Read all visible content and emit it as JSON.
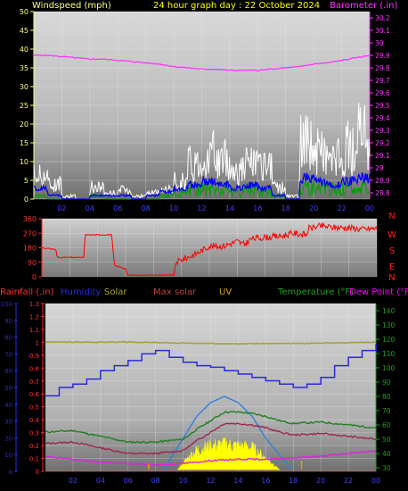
{
  "header": {
    "windspeed_label": "Windspeed (mph)",
    "title": "24 hour graph day : 22 October 2024",
    "barometer_label": "Barometer (.in)"
  },
  "legend3": {
    "rainfall": "Rainfall (.in)",
    "humidity": "Humidity",
    "solar": "Solar",
    "max_solar": "Max solar",
    "uv": "UV",
    "temperature": "Temperature (°F)",
    "dew_point": "Dew Point (°F)"
  },
  "compass": [
    "N",
    "W",
    "S",
    "E",
    "N"
  ],
  "colors": {
    "windspeed_label": "#ffff80",
    "title": "#ffff00",
    "barometer": "#ff33ff",
    "gust": "#ffffff",
    "wind_avg": "#0000ff",
    "wind_green": "#00a000",
    "direction": "#ff0000",
    "compass": "#ff2020",
    "rain_axis": "#ff3030",
    "humidity": "#2a2ae0",
    "solar": "#b0a820",
    "max_solar": "#c04040",
    "uv": "#e0a000",
    "temperature": "#20a020",
    "dew_point": "#ff00ff",
    "solar_fill": "#ffff00",
    "max_solar_curve": "#3080e0",
    "temp_line": "#208020",
    "temp_dark_line": "#a02050",
    "dew_line": "#e020e0",
    "solar_avg_line": "#a0a040"
  },
  "chart_data": [
    {
      "type": "line",
      "name": "wind_and_barometer",
      "x_ticks": [
        "02",
        "04",
        "06",
        "08",
        "10",
        "12",
        "14",
        "16",
        "18",
        "20",
        "22",
        "00"
      ],
      "y_left_ticks": [
        "0",
        "5",
        "10",
        "15",
        "20",
        "25",
        "30",
        "35",
        "40",
        "45",
        "50"
      ],
      "y_left_range": [
        0,
        50
      ],
      "y_right_ticks": [
        "28.8",
        "28.9",
        "29",
        "29.1",
        "29.2",
        "29.3",
        "29.4",
        "29.5",
        "29.6",
        "29.7",
        "29.8",
        "29.9",
        "30",
        "30.1",
        "30.2"
      ],
      "y_right_range": [
        28.75,
        30.25
      ],
      "series": [
        {
          "name": "Barometer (.in)",
          "x": [
            0,
            1,
            2,
            3,
            4,
            5,
            6,
            7,
            8,
            9,
            10,
            11,
            12,
            13,
            14,
            15,
            16,
            17,
            18,
            19,
            20,
            21,
            22,
            23,
            24
          ],
          "values": [
            29.9,
            29.9,
            29.89,
            29.88,
            29.87,
            29.87,
            29.86,
            29.85,
            29.84,
            29.83,
            29.81,
            29.8,
            29.79,
            29.79,
            29.78,
            29.78,
            29.78,
            29.79,
            29.8,
            29.81,
            29.83,
            29.84,
            29.86,
            29.88,
            29.9
          ]
        }
      ],
      "wind_gust_hourly": [
        8,
        5,
        1,
        0,
        4,
        2,
        3,
        1,
        2,
        3,
        6,
        12,
        15,
        13,
        10,
        12,
        10,
        4,
        1,
        19,
        16,
        13,
        17,
        21
      ],
      "wind_avg_hourly": [
        3,
        1,
        0,
        0,
        1,
        1,
        1,
        0,
        1,
        2,
        3,
        4,
        5,
        4,
        3,
        4,
        3,
        1,
        0,
        6,
        5,
        4,
        5,
        6
      ],
      "wind_green_hourly": [
        1,
        0,
        0,
        0,
        1,
        0,
        0,
        0,
        0,
        1,
        2,
        3,
        3,
        3,
        2,
        3,
        2,
        1,
        0,
        4,
        3,
        3,
        3,
        3
      ]
    },
    {
      "type": "line",
      "name": "wind_direction",
      "y_ticks": [
        "0",
        "90",
        "180",
        "270",
        "360"
      ],
      "y_range": [
        0,
        360
      ],
      "x": [
        0,
        1,
        1.1,
        3,
        3.1,
        5,
        5.2,
        6,
        6.1,
        9.5,
        9.6,
        11,
        12,
        13,
        14,
        14.5,
        15,
        16,
        17,
        18,
        19,
        19.1,
        20,
        21,
        22,
        23,
        24
      ],
      "values": [
        180,
        170,
        120,
        120,
        260,
        260,
        70,
        50,
        10,
        10,
        90,
        140,
        190,
        190,
        220,
        200,
        235,
        245,
        250,
        270,
        260,
        300,
        315,
        305,
        305,
        295,
        300
      ]
    },
    {
      "type": "line",
      "name": "rain_humidity_solar_temp",
      "y_left_rain_ticks": [
        "0",
        "0.1",
        "0.2",
        "0.3",
        "0.4",
        "0.5",
        "0.6",
        "0.7",
        "0.8",
        "0.9",
        "1",
        "1.1",
        "1.2",
        "1.3"
      ],
      "y_left_rain_range": [
        0,
        1.3
      ],
      "y_left_hum_ticks": [
        "0",
        "10",
        "20",
        "30",
        "40",
        "50",
        "60",
        "70",
        "80",
        "90",
        "100"
      ],
      "y_left_hum_range": [
        0,
        100
      ],
      "y_right_ticks": [
        "30",
        "40",
        "50",
        "60",
        "70",
        "80",
        "90",
        "100",
        "110",
        "120",
        "130",
        "140"
      ],
      "y_right_range": [
        27.5,
        145
      ],
      "series": [
        {
          "name": "Humidity",
          "x": [
            0,
            1,
            2,
            3,
            4,
            5,
            6,
            7,
            8,
            9,
            10,
            11,
            12,
            13,
            14,
            15,
            16,
            17,
            18,
            19,
            20,
            21,
            22,
            23,
            24
          ],
          "values": [
            45,
            50,
            52,
            55,
            60,
            63,
            66,
            70,
            72,
            68,
            65,
            63,
            62,
            60,
            58,
            56,
            54,
            52,
            50,
            52,
            56,
            63,
            68,
            72,
            76
          ]
        },
        {
          "name": "Temperature",
          "x": [
            0,
            2,
            4,
            6,
            8,
            10,
            11,
            12,
            13,
            14,
            15,
            16,
            17,
            18,
            20,
            22,
            24
          ],
          "values": [
            55,
            56,
            52,
            48,
            48,
            50,
            57,
            63,
            69,
            69,
            68,
            66,
            63,
            61,
            62,
            60,
            58
          ]
        },
        {
          "name": "Dew Point",
          "x": [
            0,
            2,
            4,
            6,
            8,
            10,
            12,
            14,
            16,
            18,
            20,
            22,
            24
          ],
          "values": [
            38,
            36,
            34,
            33,
            32,
            33,
            35,
            36,
            36,
            37,
            38,
            40,
            42
          ]
        },
        {
          "name": "Solar average",
          "x": [
            0,
            6,
            12,
            18,
            24
          ],
          "values": [
            118,
            118,
            117,
            117,
            118
          ]
        },
        {
          "name": "Max solar",
          "x": [
            8.6,
            10,
            11,
            12,
            13,
            14,
            15,
            16,
            17.9
          ],
          "values": [
            0,
            35,
            60,
            75,
            82,
            75,
            60,
            35,
            0
          ]
        },
        {
          "name": "Solar",
          "x": [
            9.6,
            10.5,
            11,
            12,
            13,
            14,
            15,
            16,
            17
          ],
          "values": [
            0,
            18,
            25,
            30,
            32,
            30,
            28,
            15,
            0
          ]
        }
      ],
      "rainfall_total": 0
    }
  ],
  "x_ticks": [
    "02",
    "04",
    "06",
    "08",
    "10",
    "12",
    "14",
    "16",
    "18",
    "20",
    "22",
    "00"
  ]
}
